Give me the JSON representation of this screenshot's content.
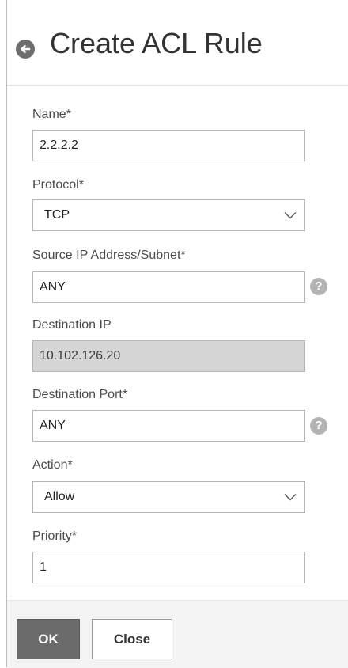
{
  "header": {
    "title": "Create ACL Rule"
  },
  "form": {
    "name": {
      "label": "Name*",
      "value": "2.2.2.2"
    },
    "protocol": {
      "label": "Protocol*",
      "value": "TCP"
    },
    "source_ip": {
      "label": "Source IP Address/Subnet*",
      "value": "ANY",
      "help": "?"
    },
    "destination_ip": {
      "label": "Destination IP",
      "value": "10.102.126.20"
    },
    "destination_port": {
      "label": "Destination Port*",
      "value": "ANY",
      "help": "?"
    },
    "action": {
      "label": "Action*",
      "value": "Allow"
    },
    "priority": {
      "label": "Priority*",
      "value": "1"
    }
  },
  "footer": {
    "ok_label": "OK",
    "close_label": "Close"
  },
  "icons": {
    "back": "arrow-left-circle-icon",
    "help": "question-circle-icon",
    "dropdown": "chevron-down-icon"
  }
}
